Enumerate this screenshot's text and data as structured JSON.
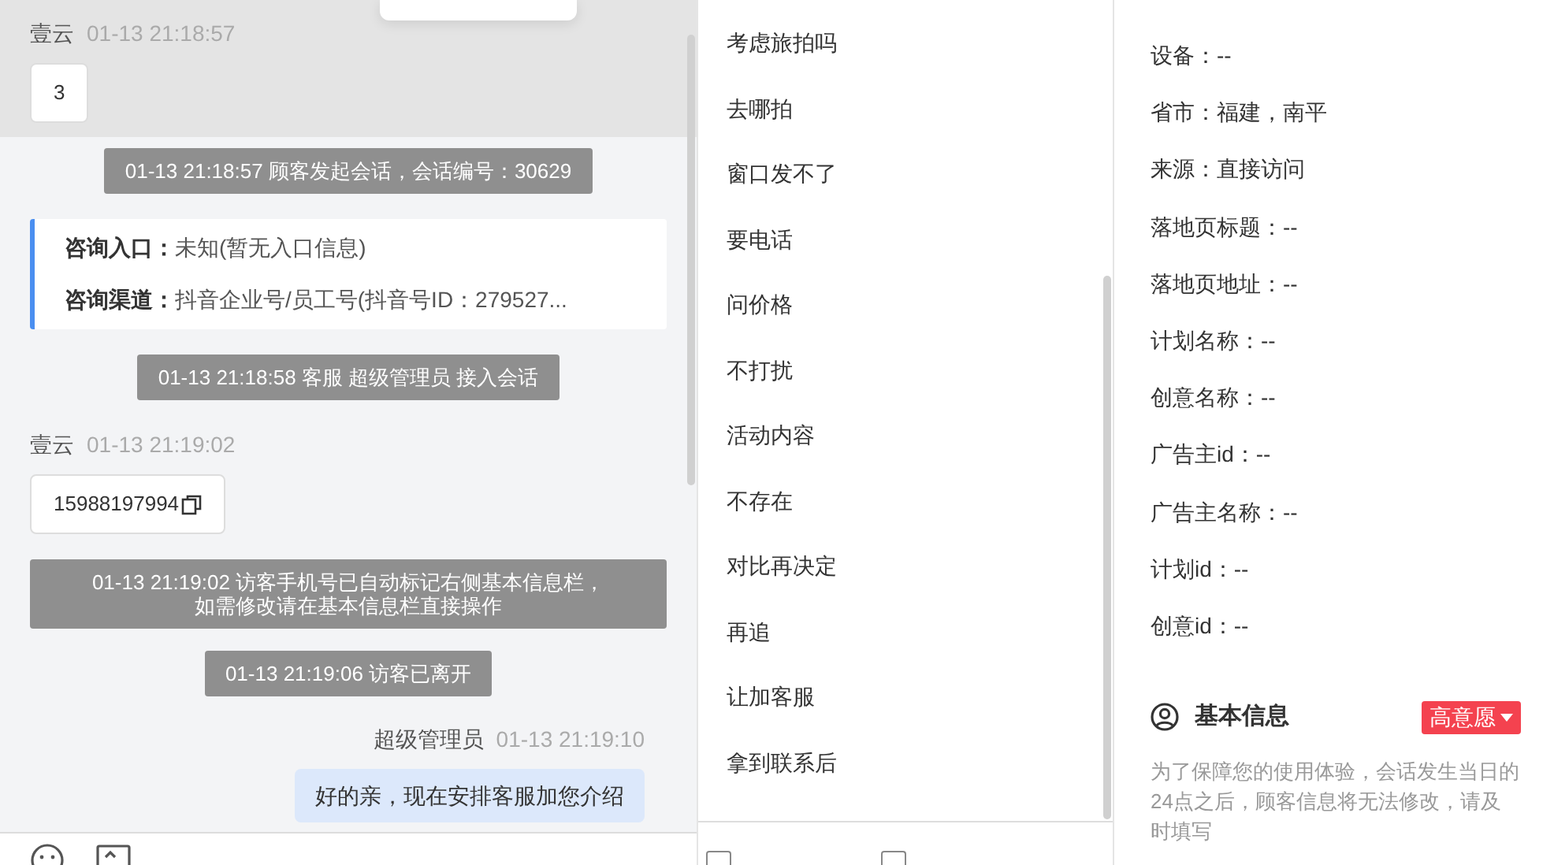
{
  "chat": {
    "messages": [
      {
        "kind": "visitor",
        "name": "壹云",
        "time": "01-13 21:18:57",
        "text": "3",
        "copyable": false,
        "highlighted": true
      },
      {
        "kind": "system",
        "text": "01-13 21:18:57 顾客发起会话，会话编号：30629"
      },
      {
        "kind": "source_card",
        "rows": [
          {
            "label": "咨询入口：",
            "value": "未知(暂无入口信息)"
          },
          {
            "label": "咨询渠道：",
            "value": "抖音企业号/员工号(抖音号ID：279527..."
          }
        ]
      },
      {
        "kind": "system",
        "text": "01-13 21:18:58 客服 超级管理员 接入会话"
      },
      {
        "kind": "visitor",
        "name": "壹云",
        "time": "01-13 21:19:02",
        "text": "15988197994",
        "copyable": true,
        "highlighted": false
      },
      {
        "kind": "system",
        "lines": [
          "01-13 21:19:02 访客手机号已自动标记右侧基本信息栏，",
          "如需修改请在基本信息栏直接操作"
        ]
      },
      {
        "kind": "system",
        "text": "01-13 21:19:06 访客已离开"
      },
      {
        "kind": "agent",
        "name": "超级管理员",
        "time": "01-13 21:19:10",
        "text": "好的亲，现在安排客服加您介绍"
      }
    ]
  },
  "quick_replies": {
    "items": [
      "考虑旅拍吗",
      "去哪拍",
      "窗口发不了",
      "要电话",
      "问价格",
      "不打扰",
      "活动内容",
      "不存在",
      "对比再决定",
      "再追",
      "让加客服",
      "拿到联系后"
    ],
    "checkboxes": [
      {
        "checked": false
      },
      {
        "checked": false
      }
    ]
  },
  "details": {
    "fields": [
      "设备：--",
      "省市：福建，南平",
      "来源：直接访问",
      "落地页标题：--",
      "落地页地址：--",
      "计划名称：--",
      "创意名称：--",
      "广告主id：--",
      "广告主名称：--",
      "计划id：--",
      "创意id：--"
    ],
    "basic_info": {
      "title": "基本信息",
      "tag": "高意愿",
      "note": "为了保障您的使用体验，会话发生当日的24点之后，顾客信息将无法修改，请及时填写"
    }
  }
}
